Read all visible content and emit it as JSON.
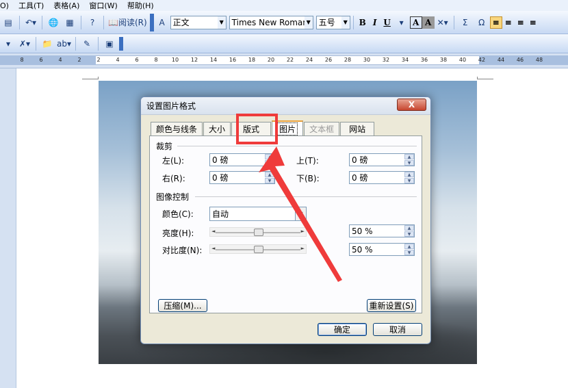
{
  "menubar": {
    "items": [
      "O)",
      "工具(T)",
      "表格(A)",
      "窗口(W)",
      "帮助(H)"
    ]
  },
  "toolbar": {
    "read_label": "阅读(R)",
    "style_value": "正文",
    "font_value": "Times New Roman",
    "size_value": "五号",
    "bold": "B",
    "italic": "I",
    "underline": "U",
    "charborder": "A",
    "charshade": "A",
    "sum": "Σ",
    "omega": "Ω"
  },
  "ruler": {
    "ticks": [
      "8",
      "6",
      "4",
      "2",
      "2",
      "4",
      "6",
      "8",
      "10",
      "12",
      "14",
      "16",
      "18",
      "20",
      "22",
      "24",
      "26",
      "28",
      "30",
      "32",
      "34",
      "36",
      "38",
      "40",
      "42",
      "44",
      "46",
      "48"
    ]
  },
  "dialog": {
    "title": "设置图片格式",
    "close_label": "X",
    "tabs": [
      {
        "label": "颜色与线条"
      },
      {
        "label": "大小"
      },
      {
        "label": "版式"
      },
      {
        "label": "图片"
      },
      {
        "label": "文本框"
      },
      {
        "label": "网站"
      }
    ],
    "crop": {
      "heading": "裁剪",
      "left_label": "左(L):",
      "left_value": "0 磅",
      "right_label": "右(R):",
      "right_value": "0 磅",
      "top_label": "上(T):",
      "top_value": "0 磅",
      "bottom_label": "下(B):",
      "bottom_value": "0 磅"
    },
    "image_control": {
      "heading": "图像控制",
      "color_label": "颜色(C):",
      "color_value": "自动",
      "brightness_label": "亮度(H):",
      "brightness_value": "50 %",
      "contrast_label": "对比度(N):",
      "contrast_value": "50 %",
      "brightness_level": 0.5,
      "contrast_level": 0.5
    },
    "compress_label": "压缩(M)...",
    "reset_label": "重新设置(S)",
    "ok_label": "确定",
    "cancel_label": "取消"
  },
  "colors": {
    "highlight": "#ef3b3b",
    "tab_accent": "#e8a03a"
  }
}
